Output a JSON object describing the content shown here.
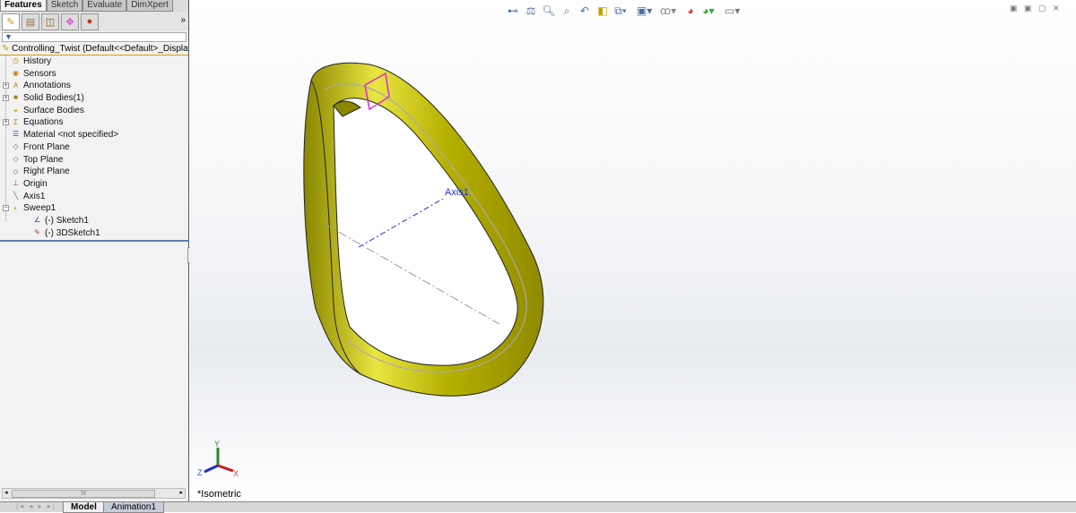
{
  "tabs": [
    "Features",
    "Sketch",
    "Evaluate",
    "DimXpert"
  ],
  "manager_icons": [
    "feature-manager-icon",
    "property-manager-icon",
    "configuration-manager-icon",
    "dimxpert-manager-icon",
    "display-manager-icon"
  ],
  "more": "»",
  "filter_icon": "funnel-icon",
  "root": "Controlling_Twist  (Default<<Default>_Display",
  "tree": [
    {
      "label": "History",
      "icon": "history-icon"
    },
    {
      "label": "Sensors",
      "icon": "sensors-icon"
    },
    {
      "label": "Annotations",
      "icon": "annotations-icon",
      "expand": "+"
    },
    {
      "label": "Solid Bodies(1)",
      "icon": "solid-bodies-icon",
      "expand": "+"
    },
    {
      "label": "Surface Bodies",
      "icon": "surface-bodies-icon"
    },
    {
      "label": "Equations",
      "icon": "equations-icon",
      "expand": "+"
    },
    {
      "label": "Material <not specified>",
      "icon": "material-icon"
    },
    {
      "label": "Front  Plane",
      "icon": "plane-icon"
    },
    {
      "label": "Top Plane",
      "icon": "plane-icon"
    },
    {
      "label": "Right Plane",
      "icon": "plane-icon"
    },
    {
      "label": "Origin",
      "icon": "origin-icon"
    },
    {
      "label": "Axis1",
      "icon": "axis-icon"
    },
    {
      "label": "Sweep1",
      "icon": "sweep-icon",
      "expand": "−"
    },
    {
      "label": "(-) Sketch1",
      "icon": "sketch-icon",
      "child": true
    },
    {
      "label": "(-) 3DSketch1",
      "icon": "3dsketch-icon",
      "child": true
    }
  ],
  "scroll_thumb": "III",
  "bottom_tabs": [
    "Model",
    "Animation1"
  ],
  "view": {
    "orientation": "*Isometric",
    "axis_label": "Axis1",
    "triad": {
      "x": "X",
      "y": "Y",
      "z": "Z"
    }
  },
  "toolbar": [
    "measure",
    "mass-properties",
    "zoom-to-fit",
    "zoom-to-area",
    "previous-view",
    "section-view",
    "view-orientation",
    "display-style",
    "hide-show",
    "edit-appearance",
    "apply-scene",
    "view-settings"
  ],
  "colors": {
    "part": "#b8b400",
    "sketch_profile": "#e020e0",
    "axis": "#2030e0"
  }
}
